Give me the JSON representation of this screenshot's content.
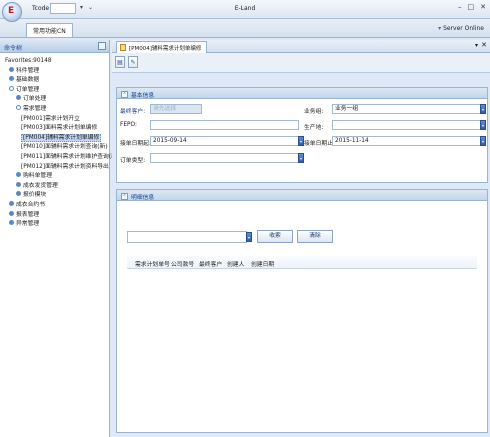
{
  "titlebar": {
    "logo": "E",
    "tcode_label": "Tcode",
    "title": "E-Land"
  },
  "ribbon": {
    "tab_common": "常用功能CN",
    "server_status": "Server Online"
  },
  "sidebar": {
    "header": "命令树",
    "favorites": "Favorites:90148",
    "items": [
      {
        "label": "科件管理",
        "level": 0
      },
      {
        "label": "基础数据",
        "level": 0
      },
      {
        "label": "订单管理",
        "level": 0
      },
      {
        "label": "订单处理",
        "level": 1
      },
      {
        "label": "需求管理",
        "level": 1
      },
      {
        "label": "[PM001]需求计划开立",
        "level": 2
      },
      {
        "label": "[PM003]面料需求计划单编修",
        "level": 2
      },
      {
        "label": "[PM004]辅料需求计划单编修",
        "level": 2,
        "selected": true
      },
      {
        "label": "[PM010]面辅料需求计划查询(新)",
        "level": 2
      },
      {
        "label": "[PM011]面辅料需求计划维护查询(新)",
        "level": 2
      },
      {
        "label": "[PM012]面辅料需求计划资料导出",
        "level": 2
      },
      {
        "label": "购料单管理",
        "level": 1
      },
      {
        "label": "成衣发货管理",
        "level": 1
      },
      {
        "label": "报价模块",
        "level": 1
      },
      {
        "label": "成衣合约书",
        "level": 0
      },
      {
        "label": "报表管理",
        "level": 0
      },
      {
        "label": "异常管理",
        "level": 0
      }
    ]
  },
  "document": {
    "tab_label": "[PM004]辅料需求计划单编修"
  },
  "basic_panel": {
    "title": "基本信息",
    "fields": {
      "customer_label": "最终客户:",
      "customer_value": "请先选择",
      "business_label": "业务组:",
      "business_value": "业务一组",
      "fepo_label": "FEPO:",
      "fepo_value": "",
      "producer_label": "生产地:",
      "producer_value": "",
      "date_start_label": "接单日期起:",
      "date_start_value": "2015-09-14",
      "date_end_label": "接单日期止:",
      "date_end_value": "2015-11-14",
      "order_type_label": "订单类型:",
      "order_type_value": ""
    }
  },
  "detail_panel": {
    "title": "明细信息",
    "search_value": "",
    "query_button": "收索",
    "clear_button": "清除",
    "columns": [
      "需求计划单号",
      "公司款号",
      "最终客户",
      "创建人",
      "创建日期"
    ]
  },
  "icons": {
    "node": "tree-node-icon",
    "toolbar": [
      "new-doc-icon",
      "edit-doc-icon"
    ]
  },
  "colors": {
    "accent": "#15428b",
    "panel_header": "#c2d5ec",
    "dropdown_button": "#2d5fae"
  }
}
